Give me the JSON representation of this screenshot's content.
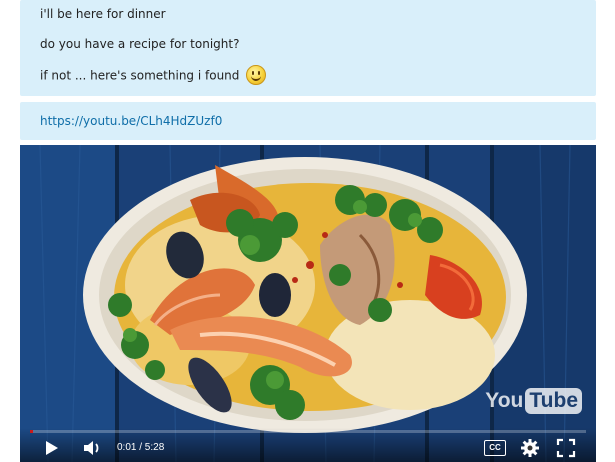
{
  "chat": {
    "messages": [
      {
        "text": "i'll be here for dinner"
      },
      {
        "text": "do you have a recipe for tonight?"
      },
      {
        "text": "if not ... here's something i found",
        "emoji": "smiley-icon"
      }
    ],
    "link": {
      "text": "https://youtu.be/CLh4HdZUzf0"
    }
  },
  "video": {
    "logo": {
      "you": "You",
      "tube": "Tube"
    },
    "player": {
      "time": "0:01 / 5:28",
      "progress": 0.003,
      "icons": [
        "play-icon",
        "volume-icon",
        "captions-icon",
        "settings-gear-icon",
        "fullscreen-icon"
      ],
      "cc_label": "CC"
    }
  },
  "colors": {
    "bubble": "#d9effa",
    "link": "#0f6ea8",
    "table_blue": "#183e73",
    "progress": "#cc1a1a"
  }
}
